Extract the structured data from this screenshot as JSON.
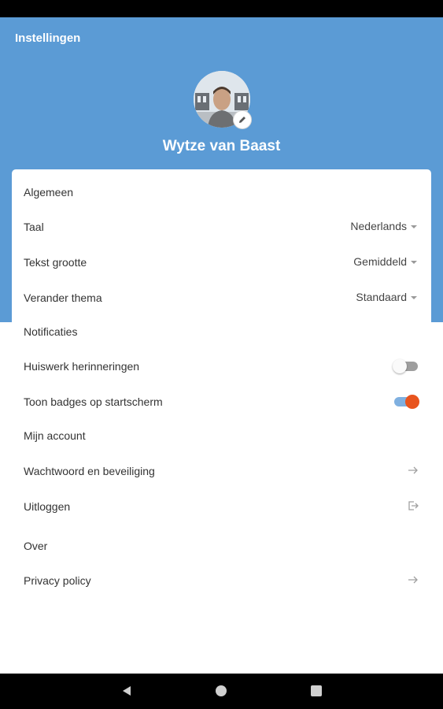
{
  "header": {
    "title": "Instellingen",
    "user_name": "Wytze van Baast"
  },
  "sections": {
    "general": {
      "title": "Algemeen",
      "language": {
        "label": "Taal",
        "value": "Nederlands"
      },
      "text_size": {
        "label": "Tekst grootte",
        "value": "Gemiddeld"
      },
      "theme": {
        "label": "Verander thema",
        "value": "Standaard"
      }
    },
    "notifications": {
      "title": "Notificaties",
      "homework": {
        "label": "Huiswerk herinneringen",
        "enabled": false
      },
      "badges": {
        "label": "Toon badges op startscherm",
        "enabled": true
      }
    },
    "account": {
      "title": "Mijn account",
      "password": {
        "label": "Wachtwoord en beveiliging",
        "icon": "arrow-right-icon"
      },
      "logout": {
        "label": "Uitloggen",
        "icon": "logout-icon"
      }
    },
    "about": {
      "title": "Over",
      "privacy": {
        "label": "Privacy policy",
        "icon": "arrow-right-icon"
      }
    }
  },
  "colors": {
    "header_bg": "#5b9bd5",
    "toggle_on": "#e8541e",
    "toggle_track_on": "#7fb0e0"
  }
}
